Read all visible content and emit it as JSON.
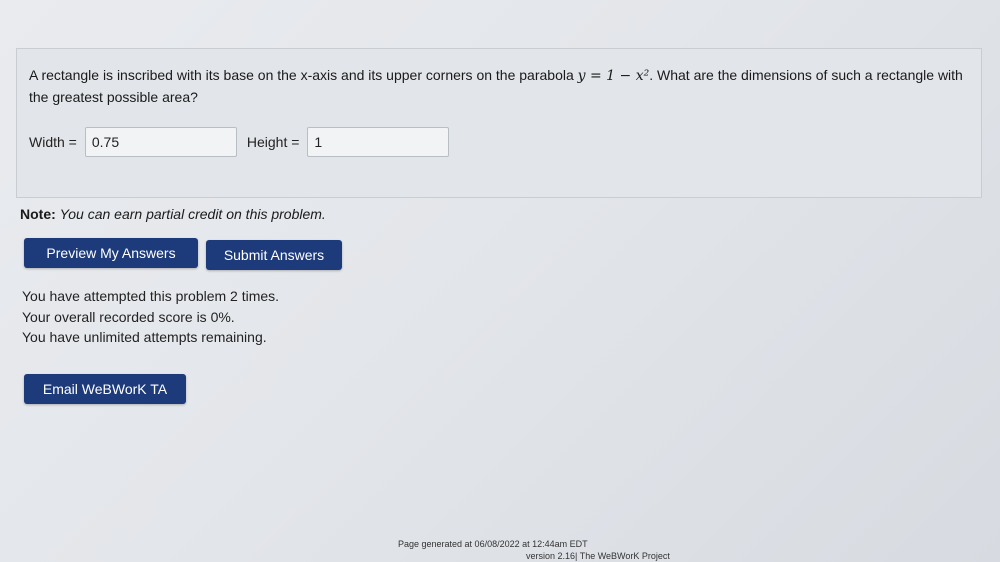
{
  "problem": {
    "text_before_math": "A rectangle is inscribed with its base on the x-axis and its upper corners on the parabola",
    "math": "y = 1 − x²",
    "text_after_math": ". What are the dimensions of such a rectangle with the greatest possible area?"
  },
  "answers": {
    "width_label": "Width =",
    "width_value": "0.75",
    "height_label": "Height =",
    "height_value": "1"
  },
  "note": {
    "label": "Note:",
    "text": "You can earn partial credit on this problem."
  },
  "buttons": {
    "preview": "Preview My Answers",
    "submit": "Submit Answers",
    "email": "Email WeBWorK TA"
  },
  "status": {
    "attempts": "You have attempted this problem 2 times.",
    "score": "Your overall recorded score is 0%.",
    "remaining": "You have unlimited attempts remaining."
  },
  "footer": {
    "generated": "Page generated at 06/08/2022 at 12:44am EDT",
    "version": "version 2.16| The WeBWorK Project"
  },
  "colors": {
    "button_bg": "#1d3a7b",
    "button_text": "#ffffff",
    "panel_bg": "#e2e5e9"
  }
}
